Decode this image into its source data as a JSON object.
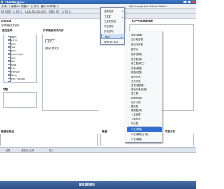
{
  "window": {
    "title": "xbeDesigner 7"
  },
  "menubar": {
    "items": [
      "文件(F)",
      "编辑(E)",
      "视图(V)",
      "工具(T)",
      "窗口(W)",
      "帮助(H)"
    ],
    "right_text": "QS Analyst Loft. Model Model"
  },
  "toolbar": {
    "field_text": "Auto Text Format"
  },
  "header": {
    "left_label": "项目选项",
    "left_sub": "选项设置文件名称",
    "right_label": "XDP代码管理选项"
  },
  "left_panel": {
    "title": "语言选择",
    "languages": [
      "Asm",
      "HTML",
      "CSS",
      "XML",
      "PHP",
      "JavaScript",
      "SQL",
      "Perl",
      "Java",
      "C#",
      "Python",
      "Ruby",
      "Hex symbol"
    ],
    "section2_title": "项目"
  },
  "mid_panel": {
    "title": "打开模板列表文件",
    "button": "打开",
    "sub": "模板列表文件"
  },
  "bottom": {
    "left": "数据收集组",
    "mid": "数据",
    "right": "项目文件"
  },
  "bottom_toolbar": {
    "a": "设置",
    "b": "设置统计文件",
    "c": "显示"
  },
  "taskbar": {
    "title": "程序项目选项"
  },
  "menu1": {
    "items": [
      {
        "label": "全局设置",
        "has_sub": true
      },
      {
        "label": "工具栏",
        "has_sub": true
      },
      {
        "label": "工具栏按钮",
        "has_sub": true
      },
      {
        "label": "项目选项",
        "has_sub": true
      },
      {
        "label": "其他选项",
        "has_sub": false
      },
      {
        "label": "帮助",
        "has_sub": true
      },
      {
        "label": "帮助文件目录",
        "has_sub": false
      }
    ],
    "highlight_index": 5
  },
  "menu2": {
    "items": [
      "简体(简体)",
      "瓦伦西亚语",
      "保加利亚语",
      "格式化",
      "繁体(繁体)",
      "荷兰语(简)",
      "荷兰语(荷兰)",
      "英语(美国)",
      "德语(德国)",
      "西班牙语",
      "意大利语",
      "俄语(俄罗斯)",
      "葡萄牙语(巴西)",
      "波兰语",
      "希腊语(简)",
      "匈牙利语",
      "捷克语",
      "挪威语(简)",
      "土耳其语",
      "立陶宛语",
      "冰岛语",
      "中文(简体)",
      "中文(繁体(台湾))",
      "中文(繁体)"
    ],
    "highlight_index": 21
  }
}
